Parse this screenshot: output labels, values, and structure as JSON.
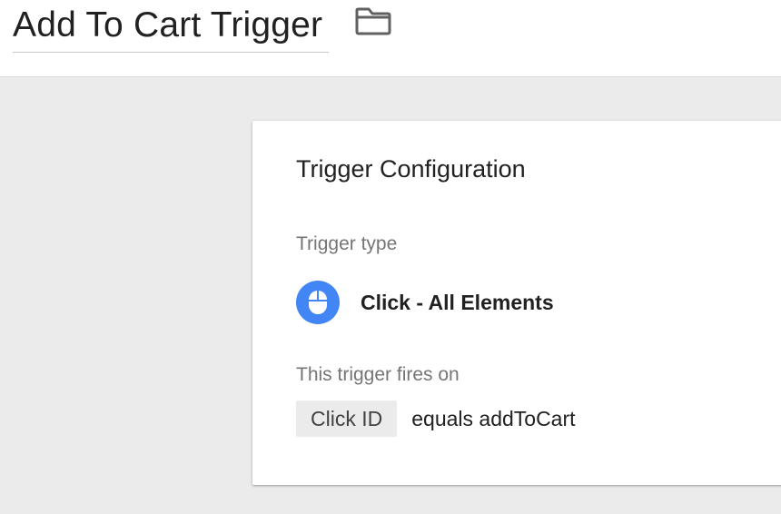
{
  "header": {
    "title": "Add To Cart Trigger",
    "folder_icon": "folder-icon"
  },
  "card": {
    "title": "Trigger Configuration",
    "trigger_type_label": "Trigger type",
    "trigger_type": {
      "icon": "mouse-click-icon",
      "name": "Click - All Elements",
      "icon_color": "#4285f4"
    },
    "fires_on_label": "This trigger fires on",
    "condition": {
      "variable": "Click ID",
      "text": "equals addToCart"
    }
  },
  "colors": {
    "page_background": "#ebebeb",
    "card_background": "#ffffff",
    "accent_blue": "#4285f4"
  }
}
